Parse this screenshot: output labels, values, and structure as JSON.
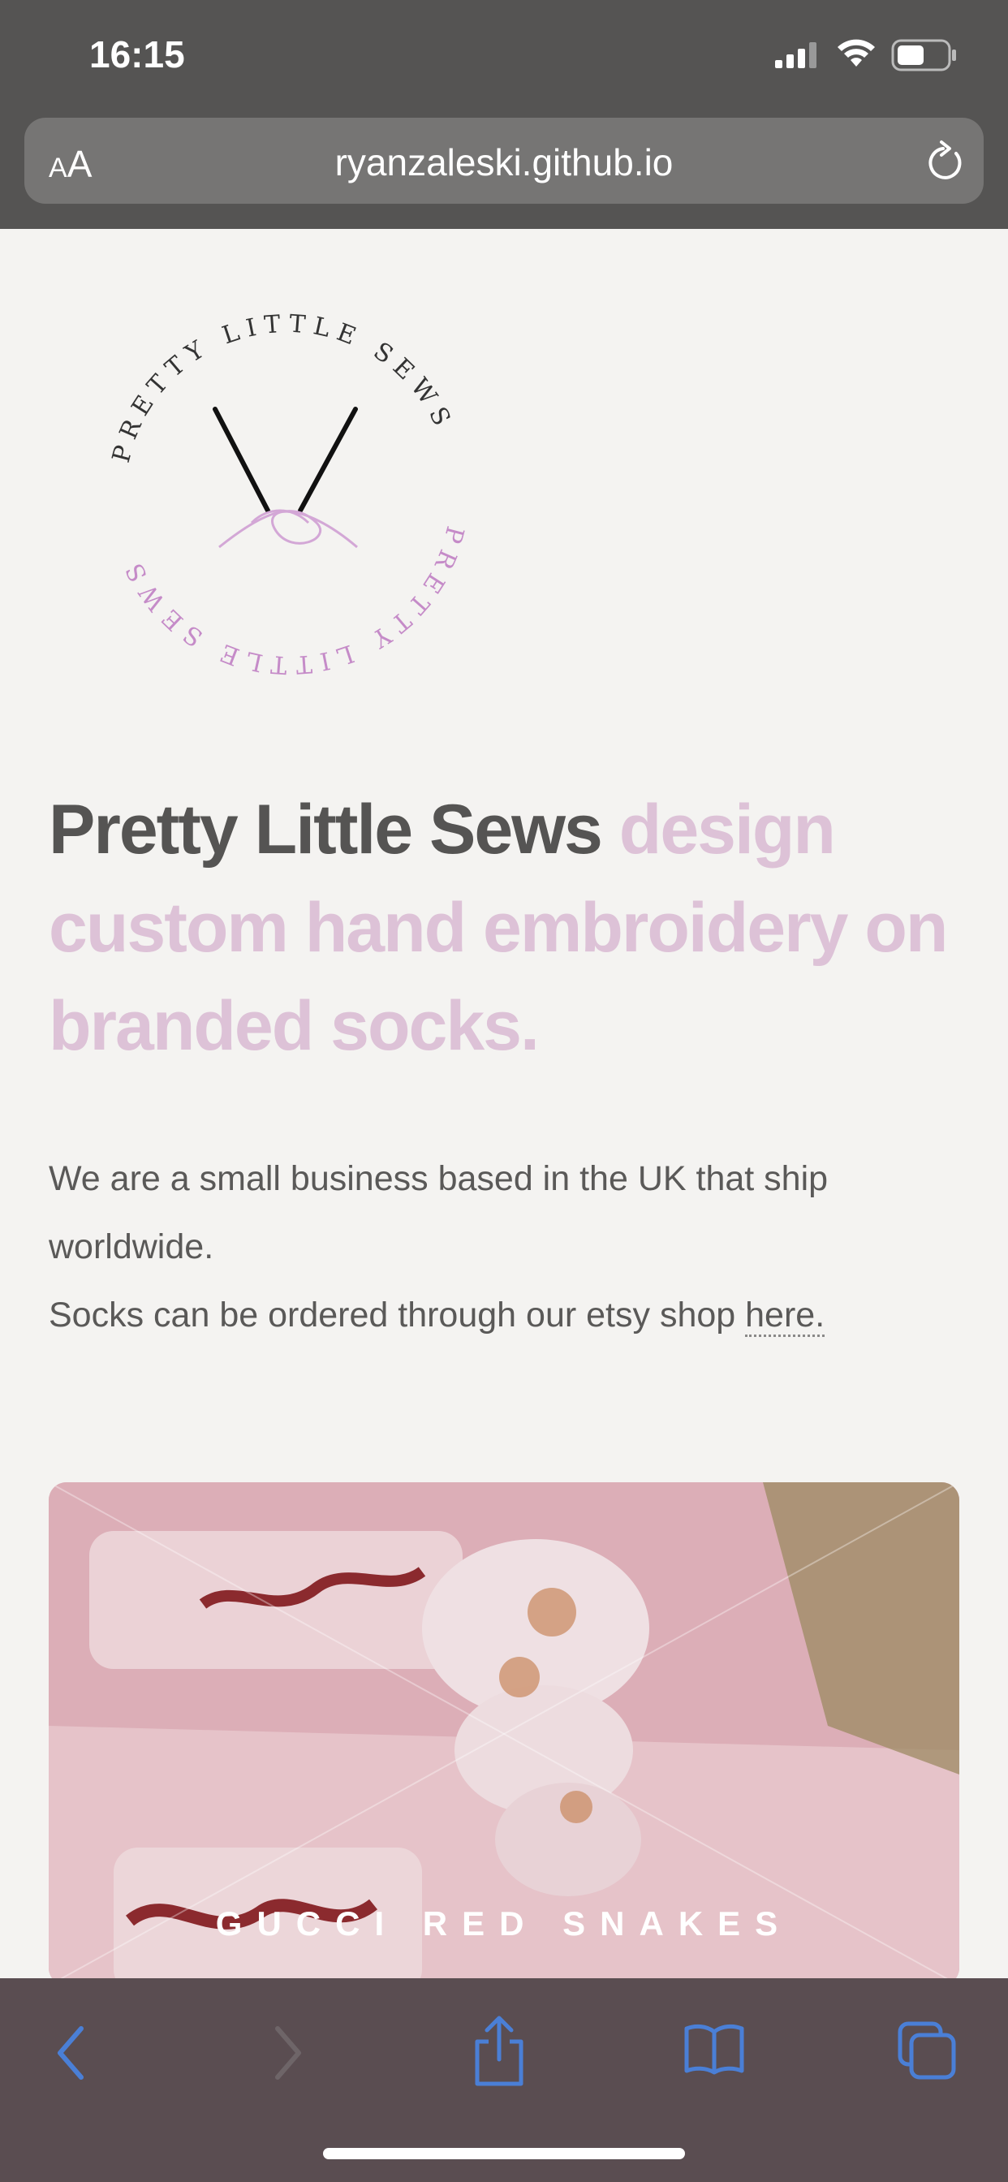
{
  "status_bar": {
    "time": "16:15"
  },
  "browser": {
    "text_size_label_small": "A",
    "text_size_label_large": "A",
    "url": "ryanzaleski.github.io"
  },
  "logo": {
    "top_text": "PRETTY LITTLE SEWS",
    "bottom_text": "PRETTY LITTLE SEWS"
  },
  "headline": {
    "brand": "Pretty Little Sews",
    "rest": " design custom hand embroidery on branded socks."
  },
  "intro": {
    "line1": "We are a small business based in the UK that ship worldwide.",
    "line2_prefix": "Socks can be ordered through our etsy shop ",
    "link": "here."
  },
  "card": {
    "title": "GUCCI RED SNAKES"
  },
  "colors": {
    "accent_pink": "#ddc2d7",
    "dark_text": "#555453",
    "toolbar_blue": "#4a7fd6"
  }
}
